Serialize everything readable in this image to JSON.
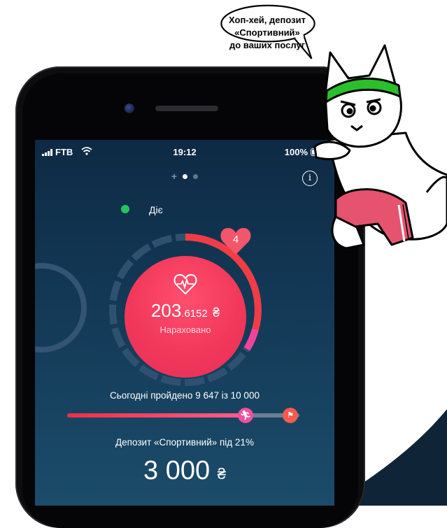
{
  "status_bar": {
    "carrier": "FTB",
    "time": "19:12",
    "battery": "100%"
  },
  "pager": {
    "plus": "+",
    "pages": 2,
    "active": 0
  },
  "header": {
    "info_icon": "i"
  },
  "deposit": {
    "state": "Діє",
    "state_color": "#22c55e",
    "hearts": "4",
    "accrued_int": "203",
    "accrued_dec": ".6152",
    "currency": "₴",
    "accrued_label": "Нараховано",
    "steps_text": "Сьогодні пройдено 9 647  із 10 000",
    "steps_done": 9647,
    "steps_goal": 10000,
    "deposit_label": "Депозит «Спортивний» під 21%",
    "deposit_amount": "3 000"
  },
  "mascot": {
    "bubble_line1": "Хоп-хей, депозит",
    "bubble_line2": "«Спортивний»",
    "bubble_line3": "до ваших послуг"
  },
  "colors": {
    "accent_red": "#f2385a",
    "bg_navy": "#0e2a44",
    "corner_navy": "#0f2436"
  }
}
